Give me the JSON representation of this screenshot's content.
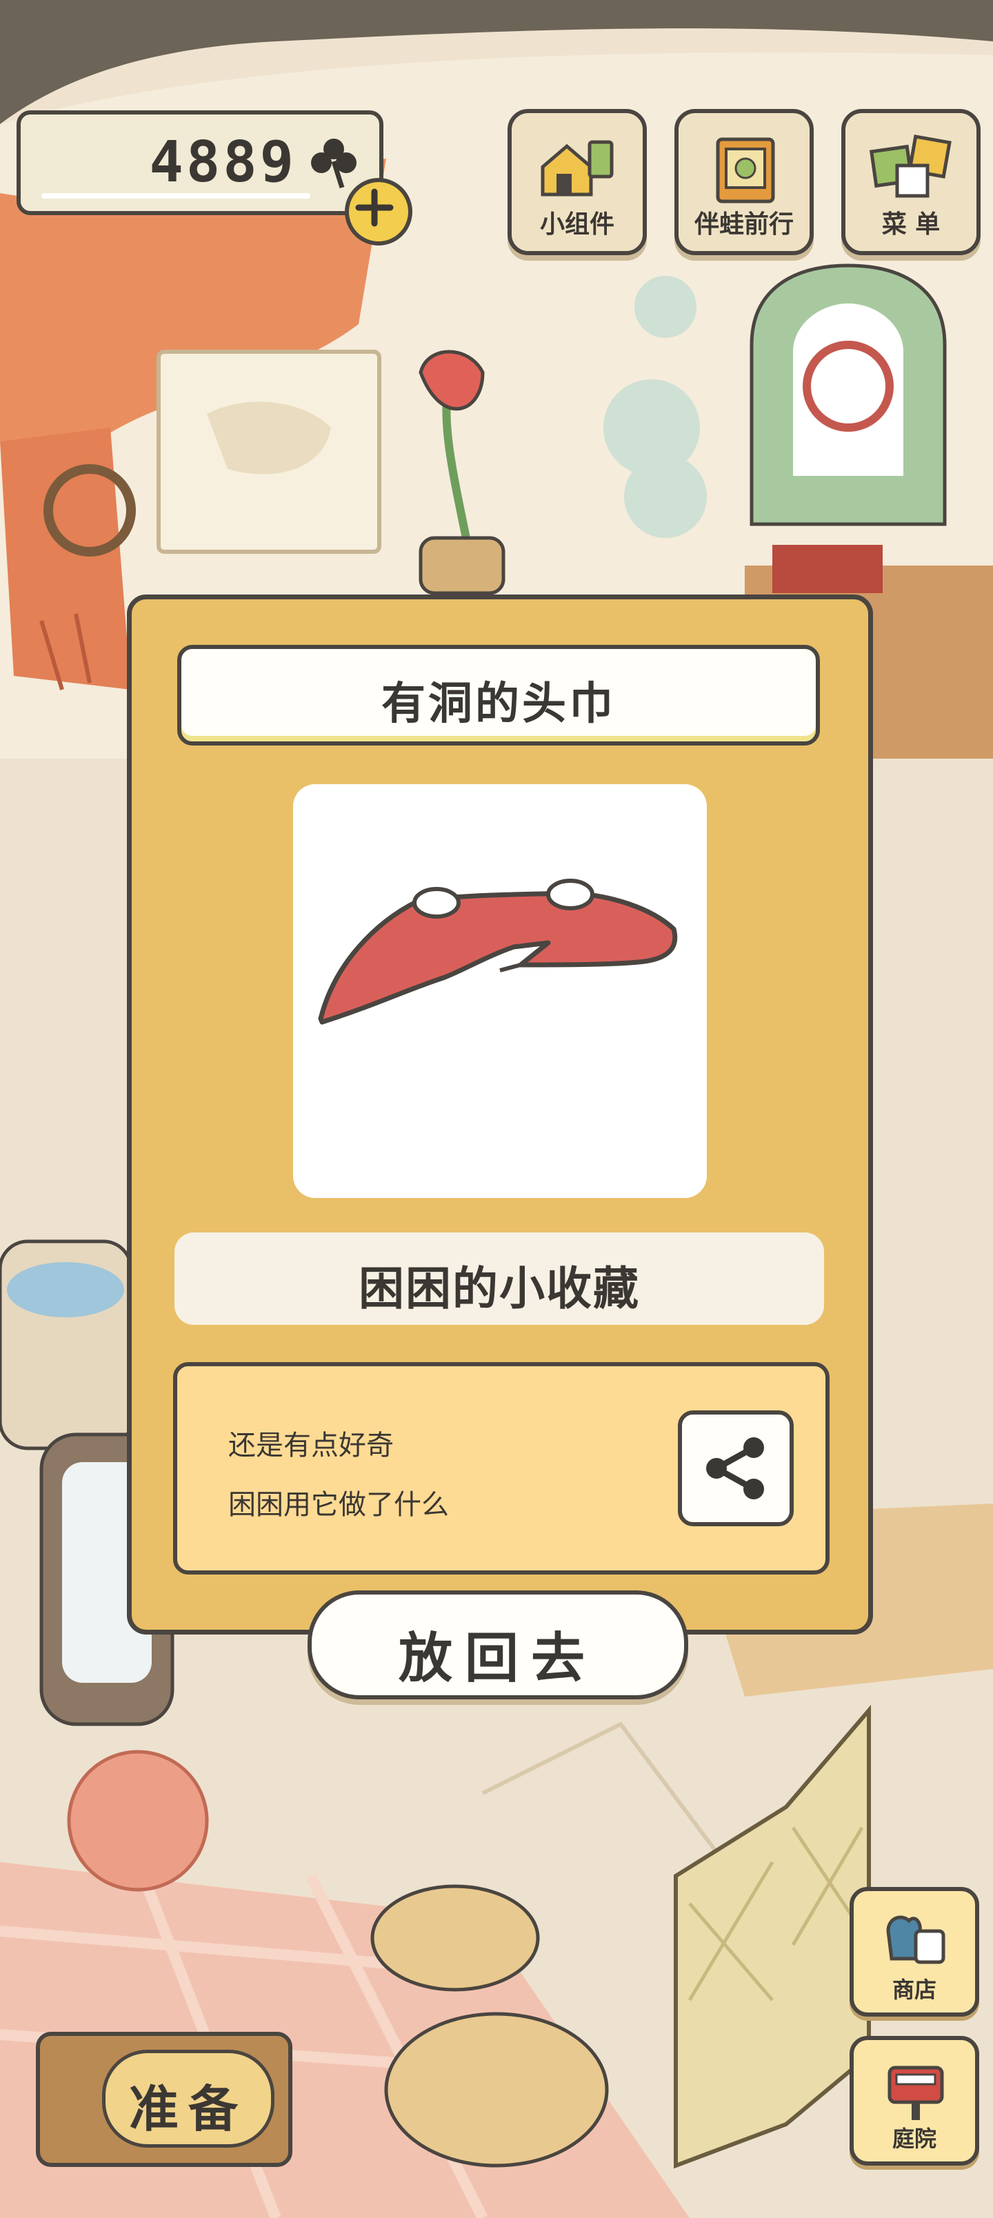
{
  "hud": {
    "clover_count": "4889",
    "widgets_label": "小组件",
    "travel_label": "伴蛙前行",
    "menu_label": "菜 单"
  },
  "item_card": {
    "name": "有洞的头巾",
    "category": "困困的小收藏",
    "description_line1": "还是有点好奇",
    "description_line2": "困困用它做了什么"
  },
  "actions": {
    "put_back_label": "放回去",
    "shop_label": "商店",
    "garden_label": "庭院",
    "prepare_label": "准备"
  },
  "colors": {
    "panel": "#e9c068",
    "outline": "#4a4540",
    "scarf": "#d9605a"
  }
}
